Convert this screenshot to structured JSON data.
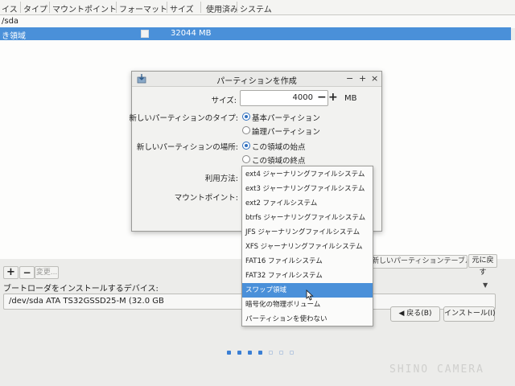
{
  "table": {
    "columns": [
      "イス",
      "タイプ",
      "マウントポイント",
      "フォーマット",
      "サイズ",
      "使用済み",
      "システム"
    ],
    "device_row": "/sda",
    "selected_row": {
      "name": "き領域",
      "size": "32044 MB"
    }
  },
  "toolbar": {
    "add_label": "+",
    "remove_label": "−",
    "change_label": "変更...",
    "new_table_label": "新しいパーティションテーブル...",
    "revert_label": "元に戻す"
  },
  "bootloader": {
    "label": "ブートローダをインストールするデバイス:",
    "value": "/dev/sda   ATA TS32GSSD25-M (32.0 GB"
  },
  "nav": {
    "back_label": "◀ 戻る(B)",
    "install_label": "インストール(I)"
  },
  "dialog": {
    "title": "パーティションを作成",
    "minimize": "−",
    "maximize": "+",
    "close": "×",
    "size_label": "サイズ:",
    "size_value": "4000",
    "size_unit": "MB",
    "type_label": "新しいパーティションのタイプ:",
    "type_primary": "基本パーティション",
    "type_logical": "論理パーティション",
    "location_label": "新しいパーティションの場所:",
    "location_start": "この領域の始点",
    "location_end": "この領域の終点",
    "use_as_label": "利用方法:",
    "mount_label": "マウントポイント:"
  },
  "dropdown": {
    "options": [
      "ext4 ジャーナリングファイルシステム",
      "ext3 ジャーナリングファイルシステム",
      "ext2 ファイルシステム",
      "btrfs ジャーナリングファイルシステム",
      "JFS ジャーナリングファイルシステム",
      "XFS ジャーナリングファイルシステム",
      "FAT16 ファイルシステム",
      "FAT32 ファイルシステム",
      "スワップ領域",
      "暗号化の物理ボリューム",
      "パーティションを使わない"
    ],
    "selected_index": 8
  },
  "watermark": "SHINO CAMERA",
  "colors": {
    "selection": "#4a90d9",
    "radio_accent": "#2f6fbf",
    "progress_dot": "#3b7fd4"
  }
}
